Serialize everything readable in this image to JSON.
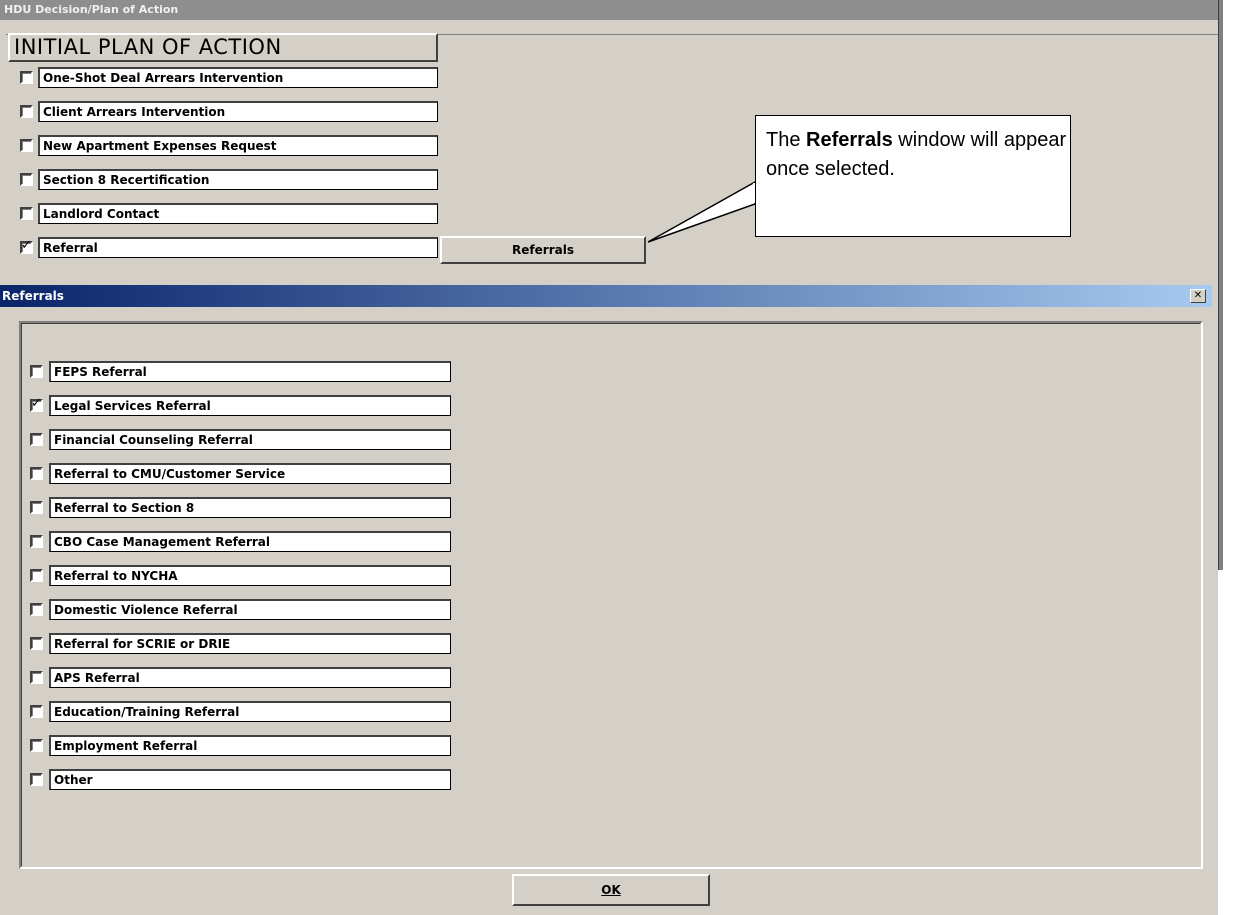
{
  "main_window": {
    "title": "HDU Decision/Plan of Action",
    "section_header": "INITIAL PLAN OF ACTION",
    "items": [
      {
        "label": "One-Shot Deal Arrears Intervention",
        "checked": false
      },
      {
        "label": "Client Arrears Intervention",
        "checked": false
      },
      {
        "label": "New Apartment Expenses Request",
        "checked": false
      },
      {
        "label": "Section 8 Recertification",
        "checked": false
      },
      {
        "label": "Landlord Contact",
        "checked": false
      },
      {
        "label": "Referral",
        "checked": true
      }
    ],
    "referrals_button": "Referrals"
  },
  "callout": {
    "prefix": "The ",
    "bold": "Referrals",
    "suffix": " window will appear once selected."
  },
  "dialog": {
    "title": "Referrals",
    "close_glyph": "✕",
    "items": [
      {
        "label": "FEPS Referral",
        "checked": false
      },
      {
        "label": "Legal Services Referral",
        "checked": true
      },
      {
        "label": "Financial Counseling Referral",
        "checked": false
      },
      {
        "label": "Referral to CMU/Customer Service",
        "checked": false
      },
      {
        "label": "Referral to Section 8",
        "checked": false
      },
      {
        "label": "CBO Case Management Referral",
        "checked": false
      },
      {
        "label": "Referral to NYCHA",
        "checked": false
      },
      {
        "label": "Domestic Violence Referral",
        "checked": false
      },
      {
        "label": "Referral for SCRIE or DRIE",
        "checked": false
      },
      {
        "label": "APS Referral",
        "checked": false
      },
      {
        "label": "Education/Training Referral",
        "checked": false
      },
      {
        "label": "Employment Referral",
        "checked": false
      },
      {
        "label": "Other",
        "checked": false
      }
    ],
    "ok_button": "OK"
  },
  "check_glyph": "✓",
  "colors": {
    "window_bg": "#d4d0c8",
    "title_active_start": "#0a246a",
    "title_active_end": "#a6caf0"
  }
}
